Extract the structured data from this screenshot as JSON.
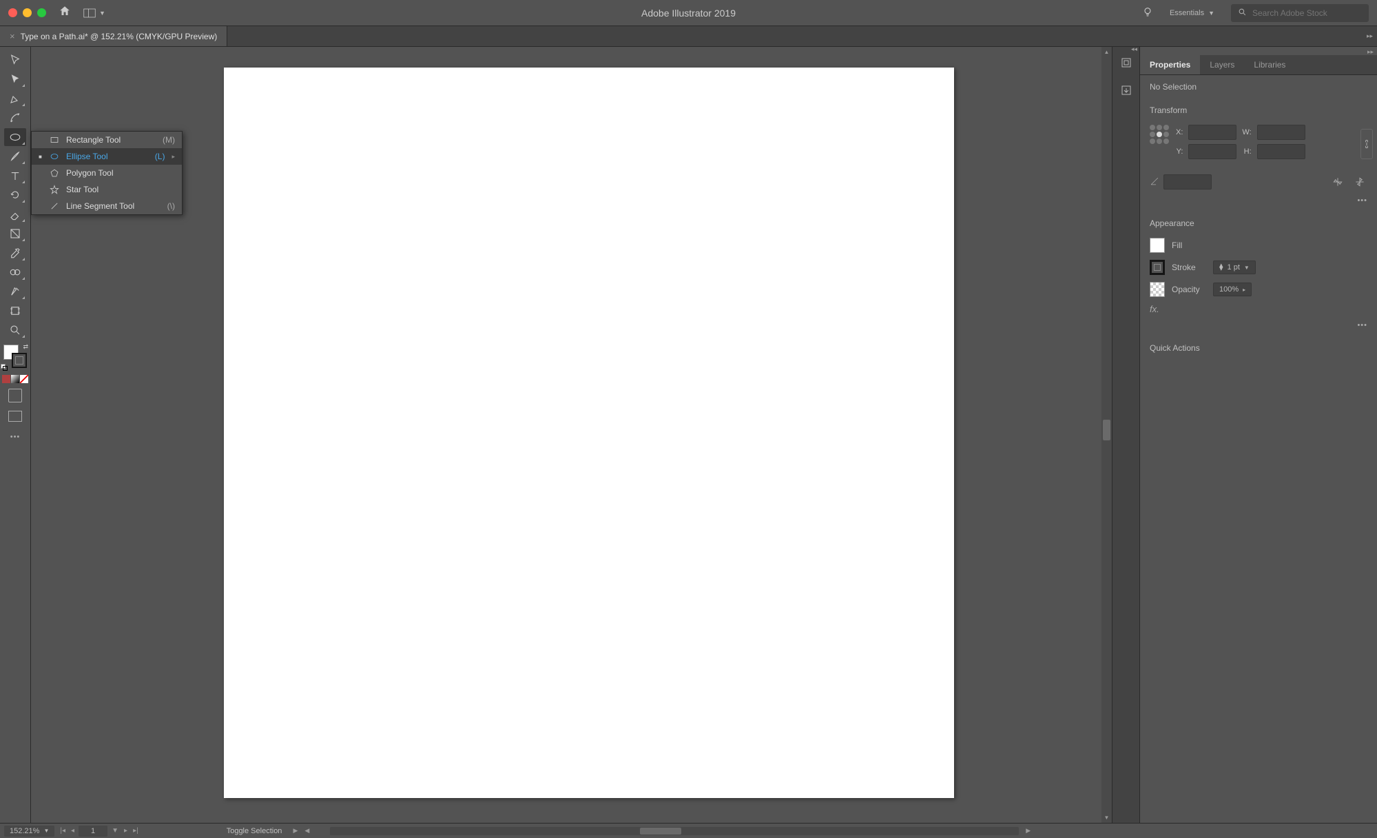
{
  "titlebar": {
    "app_title": "Adobe Illustrator 2019",
    "workspace": "Essentials",
    "search_placeholder": "Search Adobe Stock"
  },
  "doc_tab": {
    "title": "Type on a Path.ai* @ 152.21% (CMYK/GPU Preview)"
  },
  "tool_flyout": {
    "items": [
      {
        "label": "Rectangle Tool",
        "shortcut": "(M)",
        "selected": false,
        "icon": "rect"
      },
      {
        "label": "Ellipse Tool",
        "shortcut": "(L)",
        "selected": true,
        "icon": "ellipse"
      },
      {
        "label": "Polygon Tool",
        "shortcut": "",
        "selected": false,
        "icon": "polygon"
      },
      {
        "label": "Star Tool",
        "shortcut": "",
        "selected": false,
        "icon": "star"
      },
      {
        "label": "Line Segment Tool",
        "shortcut": "(\\)",
        "selected": false,
        "icon": "line"
      }
    ]
  },
  "panel_tabs": {
    "properties": "Properties",
    "layers": "Layers",
    "libraries": "Libraries"
  },
  "properties": {
    "no_selection": "No Selection",
    "transform_title": "Transform",
    "x_label": "X:",
    "y_label": "Y:",
    "w_label": "W:",
    "h_label": "H:",
    "appearance_title": "Appearance",
    "fill_label": "Fill",
    "stroke_label": "Stroke",
    "stroke_val": "1 pt",
    "opacity_label": "Opacity",
    "opacity_val": "100%",
    "quick_actions_title": "Quick Actions"
  },
  "statusbar": {
    "zoom": "152.21%",
    "artboard": "1",
    "toggle": "Toggle Selection"
  }
}
